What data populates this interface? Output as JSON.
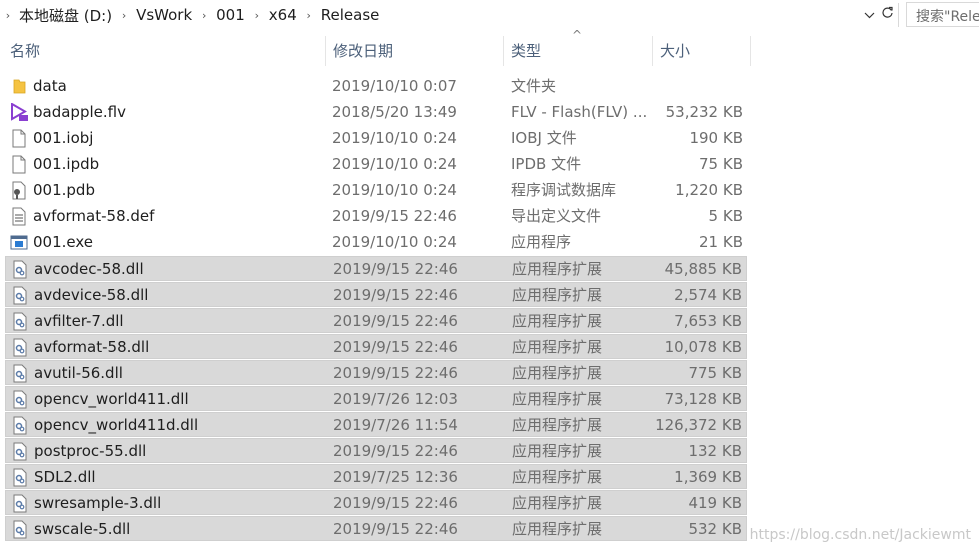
{
  "address_bar": {
    "breadcrumbs": [
      "本地磁盘 (D:)",
      "VsWork",
      "001",
      "x64",
      "Release"
    ],
    "search_placeholder": "搜索\"Release\"",
    "dropdown_icon": "chevron-down-icon",
    "refresh_icon": "refresh-icon"
  },
  "columns": {
    "name": "名称",
    "date": "修改日期",
    "type": "类型",
    "size": "大小"
  },
  "files": [
    {
      "name": "data",
      "date": "2019/10/10 0:07",
      "type": "文件夹",
      "size": "",
      "icon": "folder-icon",
      "selected": false
    },
    {
      "name": "badapple.flv",
      "date": "2018/5/20 13:49",
      "type": "FLV - Flash(FLV) ...",
      "size": "53,232 KB",
      "icon": "flv-file-icon",
      "selected": false
    },
    {
      "name": "001.iobj",
      "date": "2019/10/10 0:24",
      "type": "IOBJ 文件",
      "size": "190 KB",
      "icon": "generic-file-icon",
      "selected": false
    },
    {
      "name": "001.ipdb",
      "date": "2019/10/10 0:24",
      "type": "IPDB 文件",
      "size": "75 KB",
      "icon": "generic-file-icon",
      "selected": false
    },
    {
      "name": "001.pdb",
      "date": "2019/10/10 0:24",
      "type": "程序调试数据库",
      "size": "1,220 KB",
      "icon": "pdb-file-icon",
      "selected": false
    },
    {
      "name": "avformat-58.def",
      "date": "2019/9/15 22:46",
      "type": "导出定义文件",
      "size": "5 KB",
      "icon": "text-file-icon",
      "selected": false
    },
    {
      "name": "001.exe",
      "date": "2019/10/10 0:24",
      "type": "应用程序",
      "size": "21 KB",
      "icon": "exe-file-icon",
      "selected": false
    },
    {
      "name": "avcodec-58.dll",
      "date": "2019/9/15 22:46",
      "type": "应用程序扩展",
      "size": "45,885 KB",
      "icon": "dll-file-icon",
      "selected": true
    },
    {
      "name": "avdevice-58.dll",
      "date": "2019/9/15 22:46",
      "type": "应用程序扩展",
      "size": "2,574 KB",
      "icon": "dll-file-icon",
      "selected": true
    },
    {
      "name": "avfilter-7.dll",
      "date": "2019/9/15 22:46",
      "type": "应用程序扩展",
      "size": "7,653 KB",
      "icon": "dll-file-icon",
      "selected": true
    },
    {
      "name": "avformat-58.dll",
      "date": "2019/9/15 22:46",
      "type": "应用程序扩展",
      "size": "10,078 KB",
      "icon": "dll-file-icon",
      "selected": true
    },
    {
      "name": "avutil-56.dll",
      "date": "2019/9/15 22:46",
      "type": "应用程序扩展",
      "size": "775 KB",
      "icon": "dll-file-icon",
      "selected": true
    },
    {
      "name": "opencv_world411.dll",
      "date": "2019/7/26 12:03",
      "type": "应用程序扩展",
      "size": "73,128 KB",
      "icon": "dll-file-icon",
      "selected": true
    },
    {
      "name": "opencv_world411d.dll",
      "date": "2019/7/26 11:54",
      "type": "应用程序扩展",
      "size": "126,372 KB",
      "icon": "dll-file-icon",
      "selected": true
    },
    {
      "name": "postproc-55.dll",
      "date": "2019/9/15 22:46",
      "type": "应用程序扩展",
      "size": "132 KB",
      "icon": "dll-file-icon",
      "selected": true
    },
    {
      "name": "SDL2.dll",
      "date": "2019/7/25 12:36",
      "type": "应用程序扩展",
      "size": "1,369 KB",
      "icon": "dll-file-icon",
      "selected": true
    },
    {
      "name": "swresample-3.dll",
      "date": "2019/9/15 22:46",
      "type": "应用程序扩展",
      "size": "419 KB",
      "icon": "dll-file-icon",
      "selected": true
    },
    {
      "name": "swscale-5.dll",
      "date": "2019/9/15 22:46",
      "type": "应用程序扩展",
      "size": "532 KB",
      "icon": "dll-file-icon",
      "selected": true
    }
  ],
  "watermark": "https://blog.csdn.net/Jackiewmt",
  "colors": {
    "selection_bg": "#d9d9d9",
    "header_text": "#4c607a",
    "folder_yellow": "#f5c342",
    "flv_purple": "#8a3fd1"
  }
}
